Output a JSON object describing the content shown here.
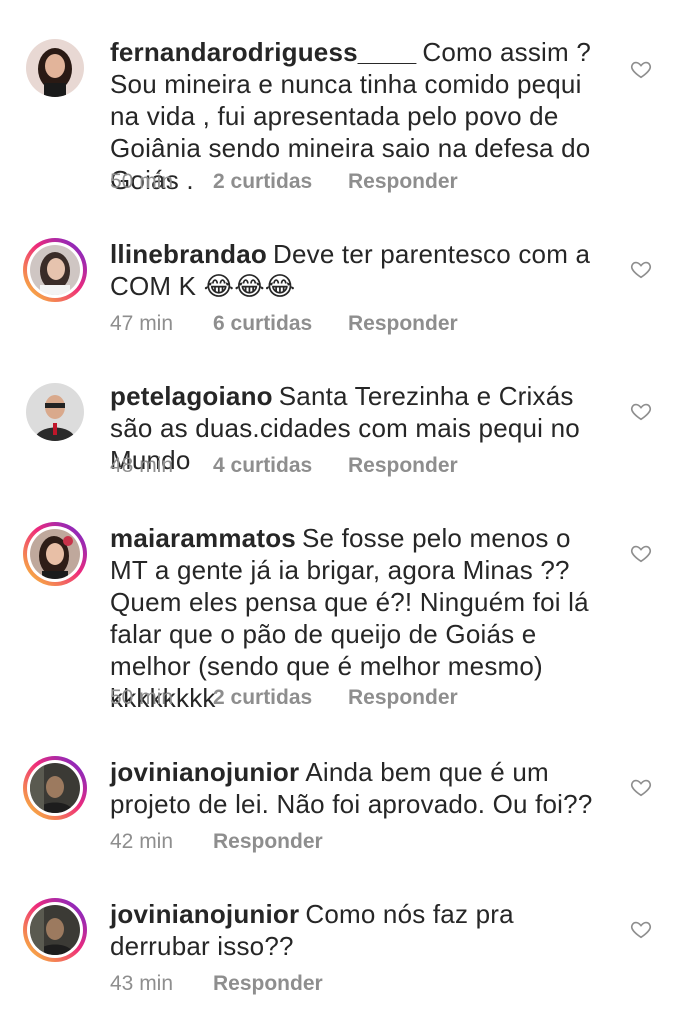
{
  "comments": [
    {
      "username": "fernandarodriguess____",
      "text": "Como assim ? Sou mineira e nunca tinha comido pequi na vida , fui apresentada pelo povo de Goiânia sendo mineira saio na defesa do Goiás .",
      "time": "50 min",
      "likes": "2 curtidas",
      "reply": "Responder"
    },
    {
      "username": "llinebrandao",
      "text": "Deve ter parentesco com a COM K 😂😂😂",
      "time": "47 min",
      "likes": "6 curtidas",
      "reply": "Responder"
    },
    {
      "username": "petelagoiano",
      "text": "Santa Terezinha e Crixás são as duas.cidades com mais pequi no Mundo",
      "time": "48 min",
      "likes": "4 curtidas",
      "reply": "Responder"
    },
    {
      "username": "maiarammatos",
      "text": "Se fosse pelo menos o MT a gente já ia brigar, agora Minas ?? Quem eles pensa que é?! Ninguém foi lá falar que o pão de queijo de Goiás e melhor (sendo que é melhor mesmo) kkkkkkkk",
      "time": "50 min",
      "likes": "2 curtidas",
      "reply": "Responder"
    },
    {
      "username": "jovinianojunior",
      "text": "Ainda bem que é um projeto de lei. Não foi aprovado. Ou foi??",
      "time": "42 min",
      "reply": "Responder"
    },
    {
      "username": "jovinianojunior",
      "text": "Como nós faz pra derrubar isso??",
      "time": "43 min",
      "reply": "Responder"
    }
  ],
  "icons": {
    "like": "heart-outline-icon"
  },
  "colors": {
    "text": "#262626",
    "meta": "#8e8e8e",
    "story_ring": [
      "#f9ce34",
      "#ee2a7b",
      "#6228d7"
    ]
  }
}
